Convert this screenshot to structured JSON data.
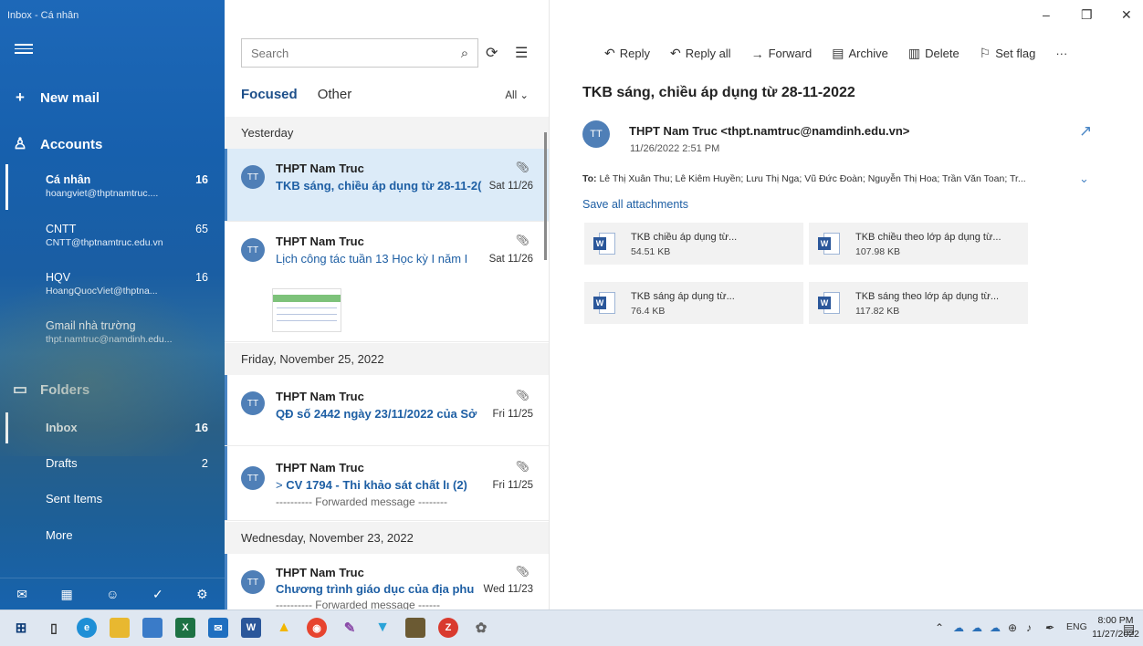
{
  "window": {
    "title": "Inbox - Cá nhân"
  },
  "sidebar": {
    "new_mail": "New mail",
    "accounts_heading": "Accounts",
    "accounts": [
      {
        "name": "Cá nhân",
        "email": "hoangviet@thptnamtruc....",
        "count": "16"
      },
      {
        "name": "CNTT",
        "email": "CNTT@thptnamtruc.edu.vn",
        "count": "65"
      },
      {
        "name": "HQV",
        "email": "HoangQuocViet@thptna...",
        "count": "16"
      },
      {
        "name": "Gmail nhà trường",
        "email": "thpt.namtruc@namdinh.edu...",
        "count": ""
      }
    ],
    "folders_heading": "Folders",
    "folders": [
      {
        "name": "Inbox",
        "count": "16"
      },
      {
        "name": "Drafts",
        "count": "2"
      },
      {
        "name": "Sent Items",
        "count": ""
      },
      {
        "name": "More",
        "count": ""
      }
    ]
  },
  "list": {
    "search_placeholder": "Search",
    "tabs": [
      "Focused",
      "Other"
    ],
    "filter": "All",
    "groups": [
      {
        "date": "Yesterday"
      },
      {
        "date": "Friday, November 25, 2022"
      },
      {
        "date": "Wednesday, November 23, 2022"
      }
    ],
    "messages": [
      {
        "initials": "TT",
        "from": "THPT Nam Truc",
        "subject": "TKB sáng, chiều áp dụng từ 28-11-2(",
        "date": "Sat 11/26",
        "preview": ""
      },
      {
        "initials": "TT",
        "from": "THPT Nam Truc",
        "subject": "Lịch công tác tuần 13 Học kỳ I năm I",
        "date": "Sat 11/26",
        "preview": ""
      },
      {
        "initials": "TT",
        "from": "THPT Nam Truc",
        "subject": "QĐ số 2442 ngày 23/11/2022 của Sở",
        "date": "Fri 11/25",
        "preview": ""
      },
      {
        "initials": "TT",
        "from": "THPT Nam Truc",
        "subject": "CV 1794 - Thi khảo sát chất lı (2)",
        "date": "Fri 11/25",
        "preview": "---------- Forwarded message --------"
      },
      {
        "initials": "TT",
        "from": "THPT Nam Truc",
        "subject": "Chương trình giáo dục của địa phu",
        "date": "Wed 11/23",
        "preview": "---------- Forwarded message ------"
      }
    ]
  },
  "reader": {
    "toolbar": {
      "reply": "Reply",
      "reply_all": "Reply all",
      "forward": "Forward",
      "archive": "Archive",
      "delete": "Delete",
      "set_flag": "Set flag",
      "more": "···"
    },
    "subject": "TKB sáng, chiều áp dụng từ 28-11-2022",
    "initials": "TT",
    "sender": "THPT Nam Truc <thpt.namtruc@namdinh.edu.vn>",
    "sent": "11/26/2022 2:51 PM",
    "to_label": "To:",
    "to": "Lê Thị Xuân Thu; Lê Kiêm Huyền; Lưu Thị Nga; Vũ Đức Đoàn; Nguyễn Thị Hoa; Trần Văn Toan; Tr...",
    "save_all": "Save all attachments",
    "attachments": [
      {
        "name": "TKB chiều áp dụng từ...",
        "size": "54.51 KB"
      },
      {
        "name": "TKB chiều theo lớp áp dụng từ...",
        "size": "107.98 KB"
      },
      {
        "name": "TKB sáng áp dụng từ...",
        "size": "76.4 KB"
      },
      {
        "name": "TKB sáng theo lớp áp dụng từ...",
        "size": "117.82 KB"
      }
    ]
  },
  "taskbar": {
    "lang": "ENG",
    "time": "8:00 PM",
    "date": "11/27/2022"
  },
  "colors": {
    "accent": "#1e5fa4",
    "sidebar": "#1763ad",
    "selected_row": "#dcebf8"
  }
}
